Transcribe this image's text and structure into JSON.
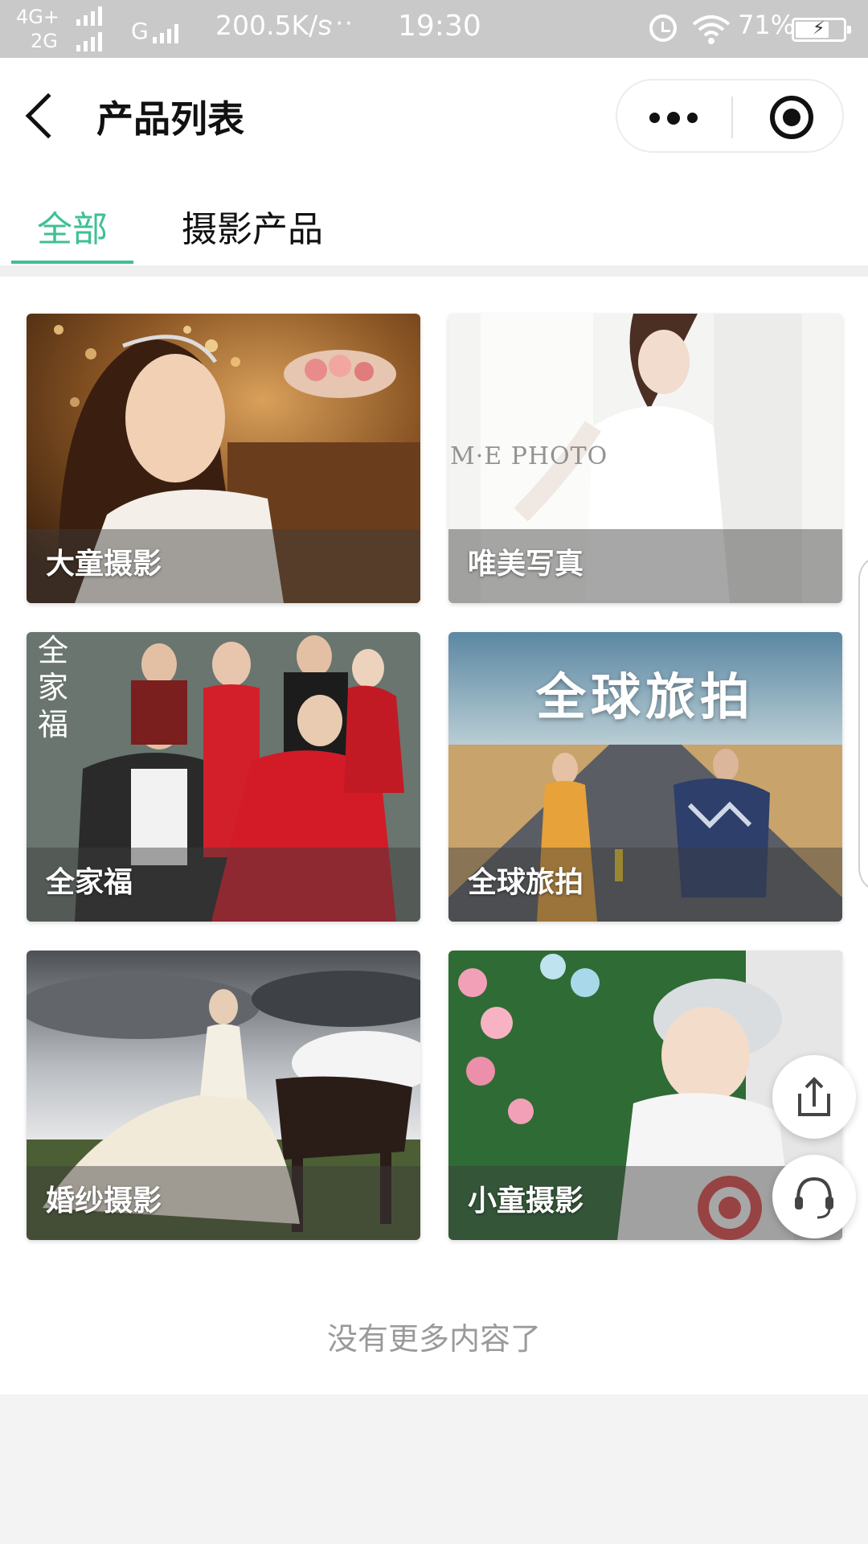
{
  "status_bar": {
    "network_top": "4G+",
    "network_bottom": "2G",
    "network_g": "G",
    "speed": "200.5K/s",
    "dots": "···",
    "time": "19:30",
    "battery": "71%",
    "battery_level": 0.71
  },
  "nav": {
    "title": "产品列表"
  },
  "tabs": [
    {
      "label": "全部",
      "active": true
    },
    {
      "label": "摄影产品",
      "active": false
    }
  ],
  "products": [
    {
      "label": "大童摄影",
      "image_desc": "girl-dinner-portrait"
    },
    {
      "label": "唯美写真",
      "image_desc": "woman-white-curtain",
      "watermark": "M·E PHOTO"
    },
    {
      "label": "全家福",
      "image_desc": "family-portrait",
      "side_text": "全家福"
    },
    {
      "label": "全球旅拍",
      "image_desc": "couple-on-road",
      "banner_text": "全球旅拍"
    },
    {
      "label": "婚纱摄影",
      "image_desc": "bride-with-horse"
    },
    {
      "label": "小童摄影",
      "image_desc": "baby-with-hat"
    }
  ],
  "end_text": "没有更多内容了",
  "colors": {
    "accent": "#3fbf95",
    "statusbar": "#c9c9c9"
  },
  "icons": [
    "back-arrow-icon",
    "more-icon",
    "target-icon",
    "share-icon",
    "headset-icon"
  ]
}
